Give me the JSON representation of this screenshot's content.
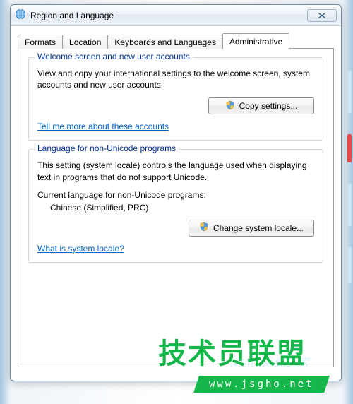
{
  "window": {
    "title": "Region and Language"
  },
  "tabs": {
    "items": [
      {
        "label": "Formats"
      },
      {
        "label": "Location"
      },
      {
        "label": "Keyboards and Languages"
      },
      {
        "label": "Administrative"
      }
    ],
    "active_index": 3
  },
  "group1": {
    "legend": "Welcome screen and new user accounts",
    "text": "View and copy your international settings to the welcome screen, system accounts and new user accounts.",
    "button": "Copy settings...",
    "link": "Tell me more about these accounts"
  },
  "group2": {
    "legend": "Language for non-Unicode programs",
    "text": "This setting (system locale) controls the language used when displaying text in programs that do not support Unicode.",
    "current_label": "Current language for non-Unicode programs:",
    "current_value": "Chinese (Simplified, PRC)",
    "button": "Change system locale...",
    "link": "What is system locale?"
  },
  "watermark": {
    "main": "技术员联盟",
    "sub": "Win7系统之家",
    "url": "www.jsgho.net"
  }
}
